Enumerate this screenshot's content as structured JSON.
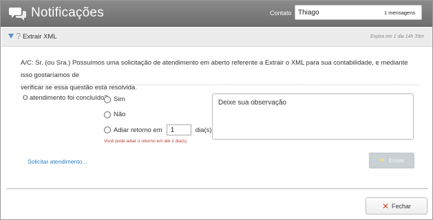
{
  "header": {
    "title": "Notificações",
    "icon": "chat-bubbles-icon",
    "contact_label": "Contato",
    "contact_name": "Thiago",
    "message_count": "1 mensagens"
  },
  "section": {
    "title": "Extrair XML",
    "expiry": "Expira em 1 dia 14h 39m"
  },
  "body": {
    "line1": "A/C: Sr. (ou Sra.) Possuímos uma solicitação de atendimento em aberto referente a Extrair o XML para sua contabilidade, e mediante isso gostaríamos de",
    "line2": "verificar se essa questão está resolvida."
  },
  "form": {
    "question": "O atendimento foi concluído?",
    "option_yes": "Sim",
    "option_no": "Não",
    "option_postpone": "Adiar retorno em",
    "days_value": "1",
    "days_suffix": "dia(s).",
    "hint": "Você pode adiar o retorno em até 1 dia(s).",
    "observation_placeholder": "Deixe sua observação"
  },
  "actions": {
    "request_link": "Solicitar atendimento...",
    "send_label": "Enviar",
    "close_label": "Fechar"
  },
  "colors": {
    "header_bg": "#7d7d7d",
    "link": "#2d7fc1",
    "hint": "#b23a2f",
    "send_disabled": "#c9d1d4",
    "close_icon": "#d9452a"
  }
}
